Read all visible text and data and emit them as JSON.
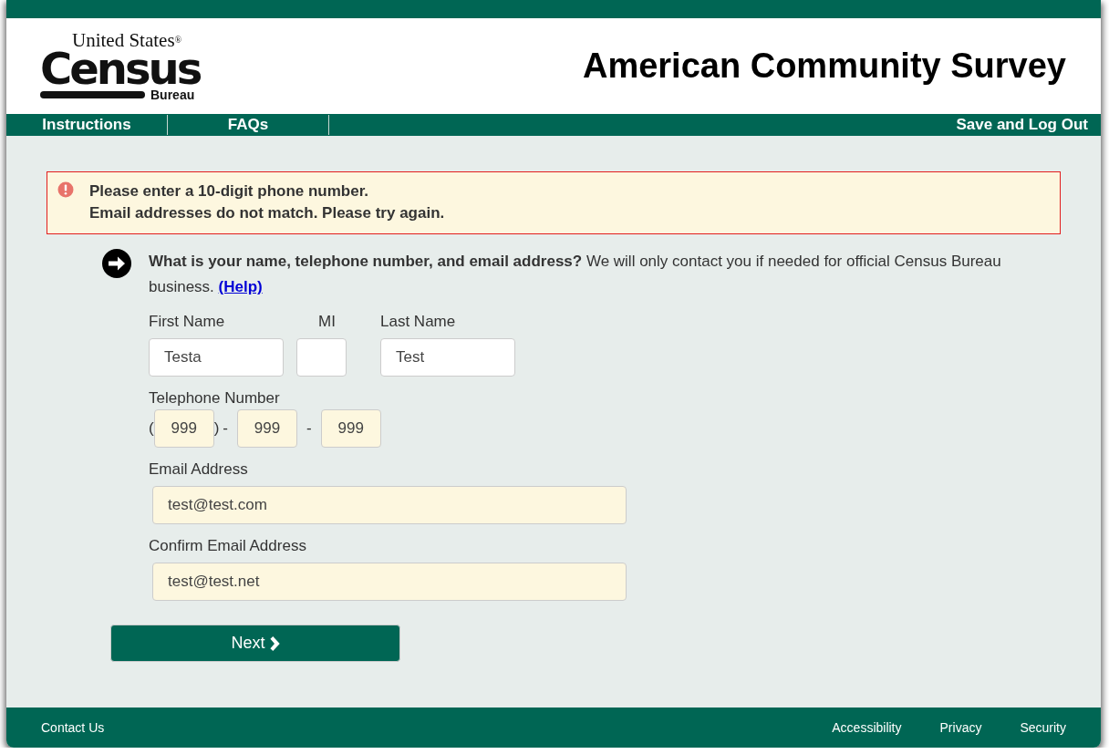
{
  "logo": {
    "top_line": "United States",
    "registered": "®",
    "main": "Census",
    "bottom": "Bureau"
  },
  "header": {
    "title": "American Community Survey"
  },
  "nav": {
    "left": [
      "Instructions",
      "FAQs"
    ],
    "right": "Save and Log Out"
  },
  "errors": [
    "Please enter a 10-digit phone number.",
    "Email addresses do not match. Please try again."
  ],
  "question": {
    "text": "**What is your name, telephone number, and email address?** We will only contact you if needed for official Census Bureau business.",
    "help": "(Help)"
  },
  "name_fields": [
    {
      "label": "First Name",
      "value": "Testa",
      "error": false
    },
    {
      "label": "MI",
      "error": false
    },
    {
      "label": "Last Name",
      "value": "Test",
      "error": false
    }
  ],
  "phone": {
    "label": "Telephone Number",
    "open": "(",
    "close": ")",
    "sep1": "-",
    "sep2": "-",
    "parts": [
      {
        "value": "999",
        "error": true
      },
      {
        "value": "999",
        "error": true
      },
      {
        "value": "999",
        "error": true
      }
    ]
  },
  "email_fields": [
    {
      "label": "Email Address",
      "value": "test@test.com",
      "error": true
    },
    {
      "label": "Confirm Email Address",
      "value": "test@test.net",
      "error": true
    }
  ],
  "next_button": "Next",
  "footer": {
    "left": "Contact Us",
    "right": [
      "Accessibility",
      "Privacy",
      "Security"
    ]
  }
}
